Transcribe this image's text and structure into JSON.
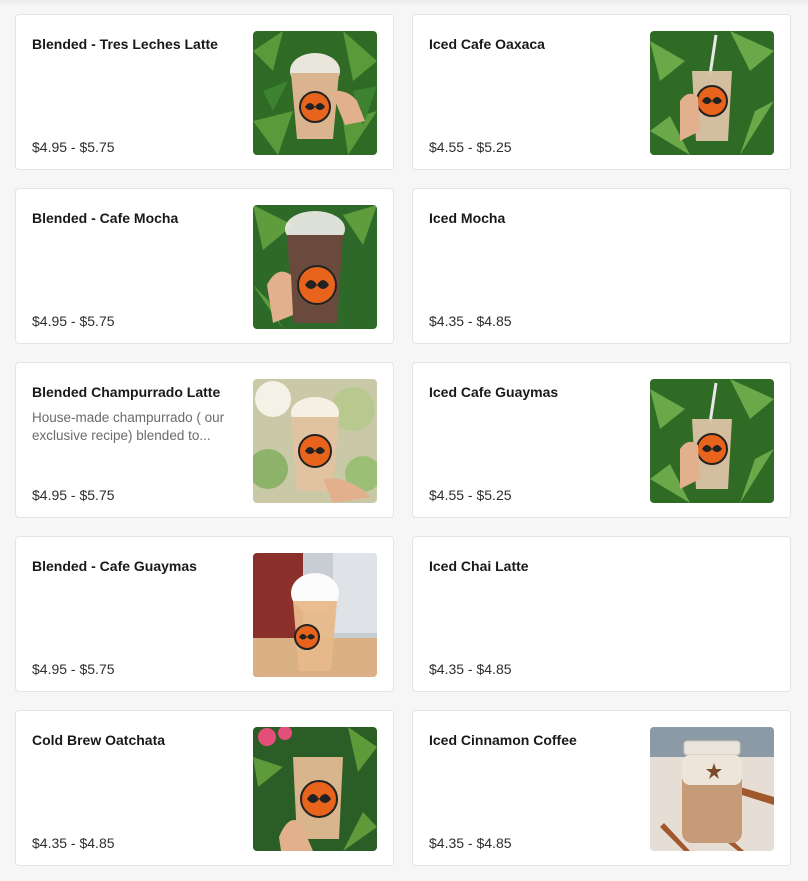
{
  "menu": {
    "items": [
      {
        "name": "Blended - Tres Leches Latte",
        "description": "",
        "price": "$4.95 - $5.75",
        "image": "blended-latte-photo"
      },
      {
        "name": "Iced Cafe Oaxaca",
        "description": "",
        "price": "$4.55 - $5.25",
        "image": "iced-cafe-photo"
      },
      {
        "name": "Blended - Cafe Mocha",
        "description": "",
        "price": "$4.95 - $5.75",
        "image": "blended-mocha-photo"
      },
      {
        "name": "Iced Mocha",
        "description": "",
        "price": "$4.35 - $4.85",
        "image": ""
      },
      {
        "name": "Blended Champurrado Latte",
        "description": "House-made champurrado ( our exclusive recipe) blended to...",
        "price": "$4.95 - $5.75",
        "image": "blended-champurrado-photo"
      },
      {
        "name": "Iced Cafe Guaymas",
        "description": "",
        "price": "$4.55 - $5.25",
        "image": "iced-cafe-photo"
      },
      {
        "name": "Blended - Cafe Guaymas",
        "description": "",
        "price": "$4.95 - $5.75",
        "image": "whipped-drink-photo"
      },
      {
        "name": "Iced Chai Latte",
        "description": "",
        "price": "$4.35 - $4.85",
        "image": ""
      },
      {
        "name": "Cold Brew Oatchata",
        "description": "",
        "price": "$4.35 - $4.85",
        "image": "cold-brew-photo"
      },
      {
        "name": "Iced Cinnamon Coffee",
        "description": "",
        "price": "$4.35 - $4.85",
        "image": "mason-jar-photo"
      }
    ]
  },
  "colors": {
    "card_background": "#ffffff",
    "card_border": "#e4e4e4",
    "page_background": "#f7f6f6",
    "brand_orange": "#e8641c",
    "foliage_green": "#2f6b25"
  }
}
